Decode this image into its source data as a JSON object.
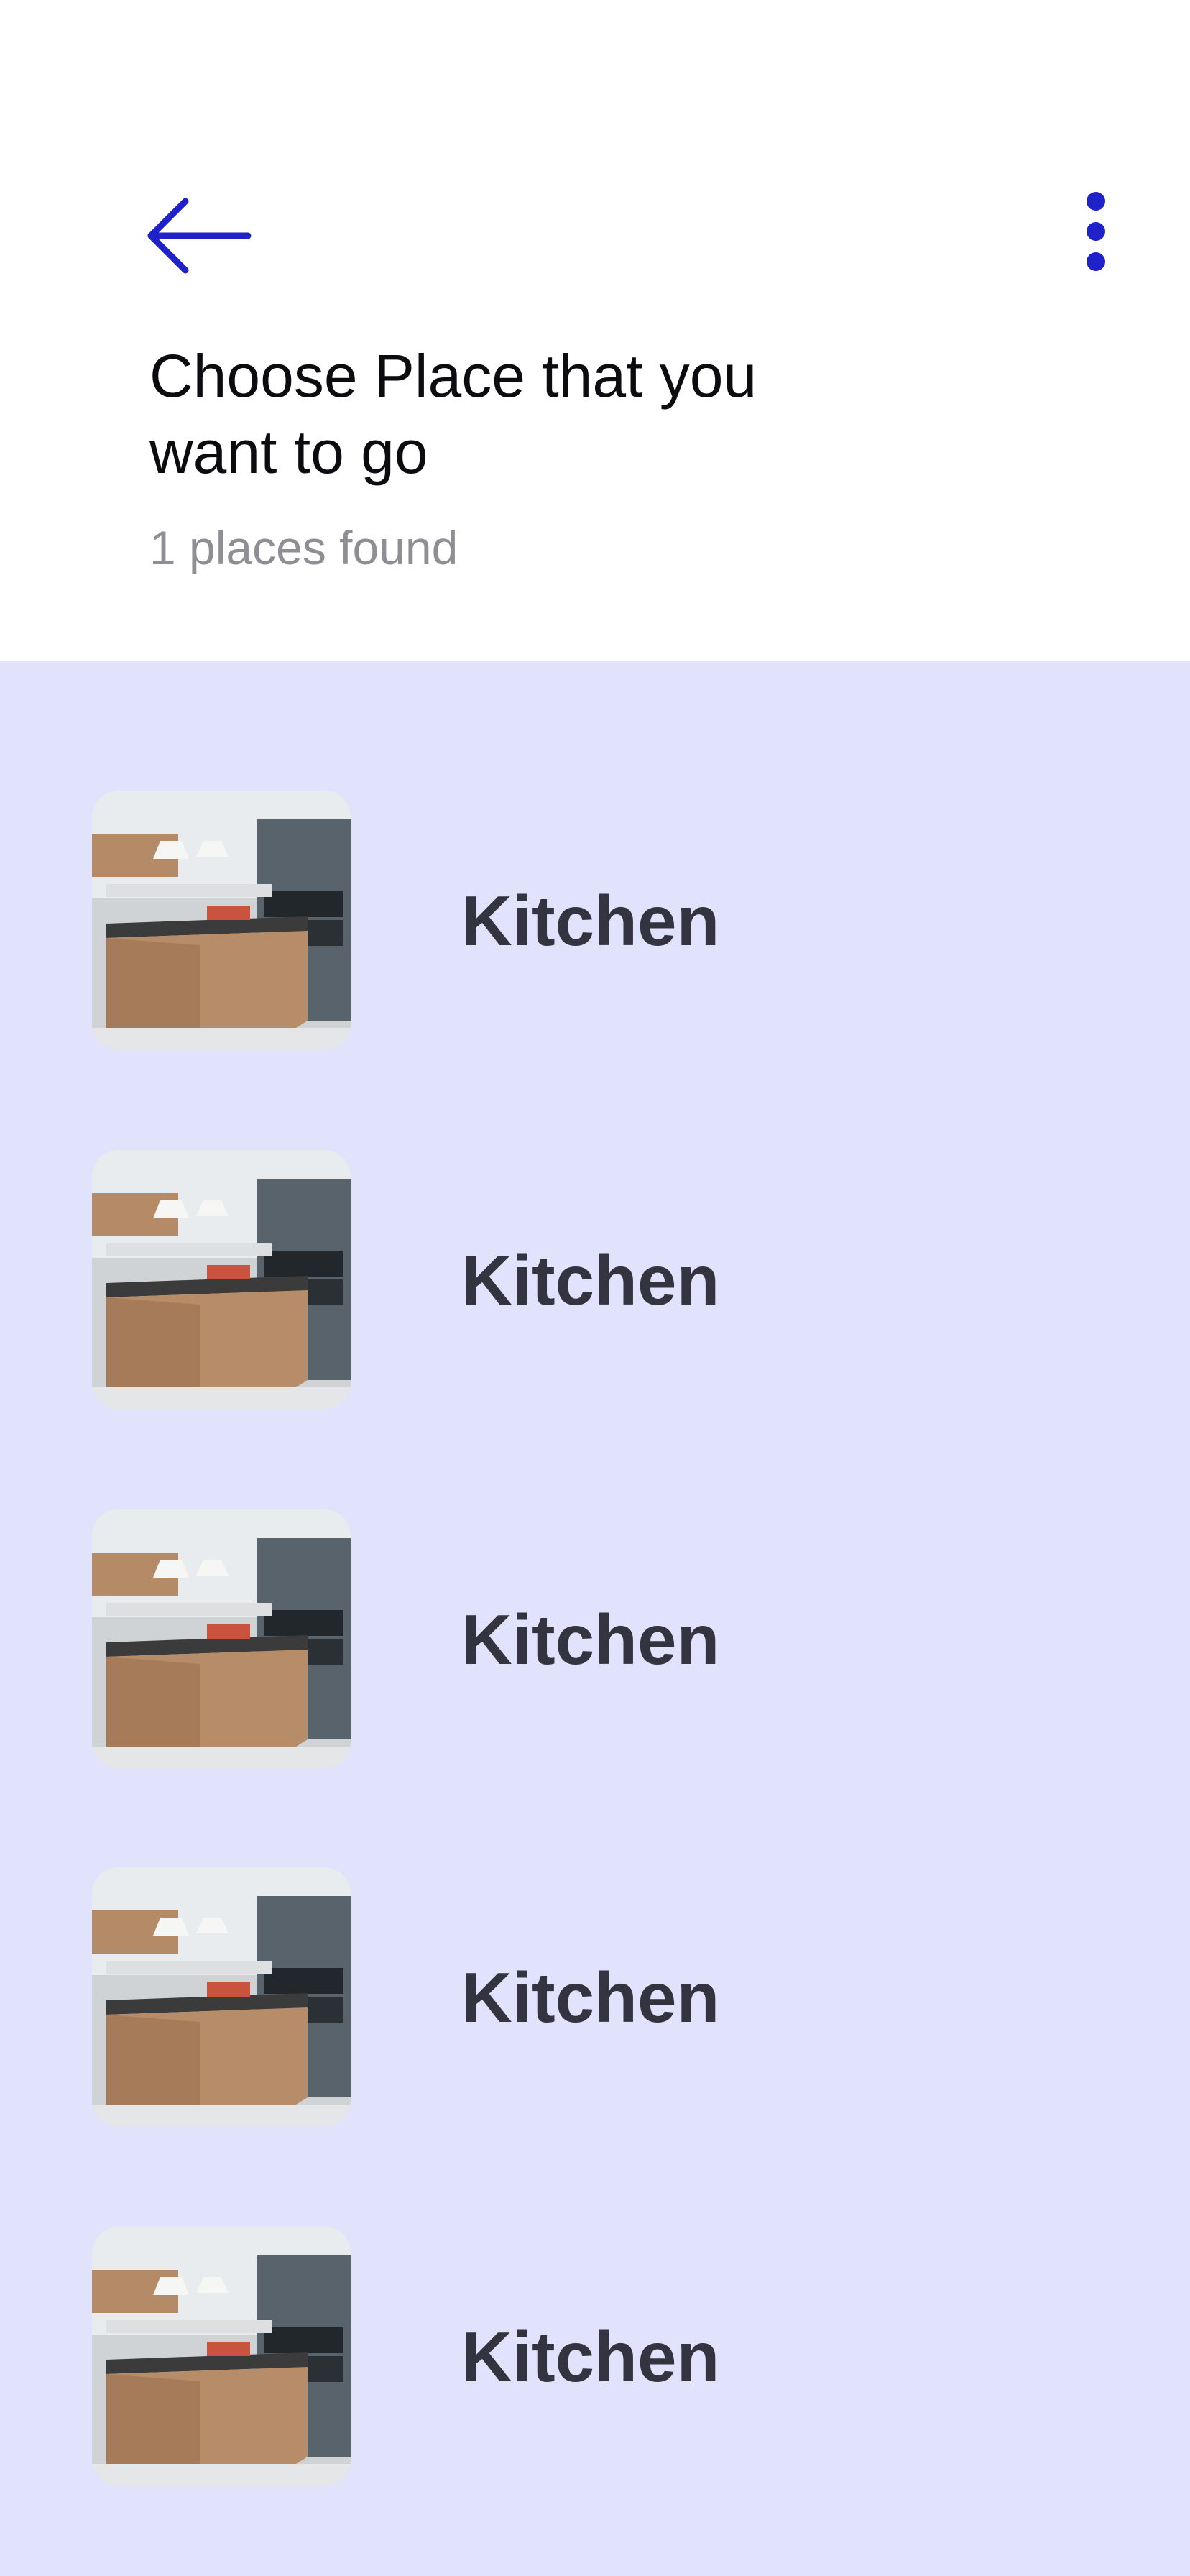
{
  "header": {
    "back_icon": "arrow-left-icon",
    "more_icon": "more-vertical-icon",
    "accent_color": "#1f22c9",
    "title": "Choose Place that you want to go",
    "subtitle": "1 places found"
  },
  "places": [
    {
      "label": "Kitchen",
      "image": "kitchen-photo"
    },
    {
      "label": "Kitchen",
      "image": "kitchen-photo"
    },
    {
      "label": "Kitchen",
      "image": "kitchen-photo"
    },
    {
      "label": "Kitchen",
      "image": "kitchen-photo"
    },
    {
      "label": "Kitchen",
      "image": "kitchen-photo"
    }
  ],
  "colors": {
    "list_background": "#e1e3fc",
    "label": "#33343f",
    "subtitle": "#8e8e94"
  }
}
